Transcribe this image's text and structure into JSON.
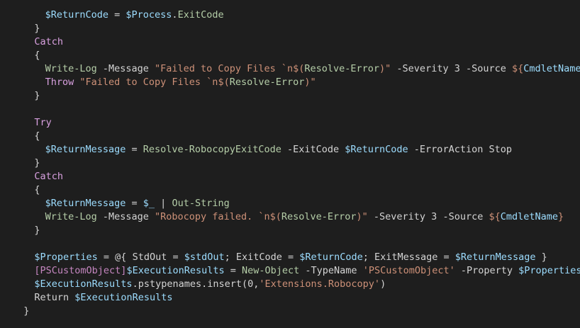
{
  "editor": {
    "theme": {
      "background": "#1e1e1e",
      "text": "#d4d4d4",
      "variable": "#9cdcfe",
      "keyword": "#d8a0df",
      "cmdlet": "#b5cea8",
      "string": "#ce9178",
      "type": "#c586c0"
    },
    "lines": [
      {
        "indent": 3,
        "tokens": [
          [
            "var",
            "$ReturnCode"
          ],
          [
            "default",
            " = "
          ],
          [
            "var",
            "$Process"
          ],
          [
            "default",
            "."
          ],
          [
            "cmdlet",
            "ExitCode"
          ]
        ]
      },
      {
        "indent": 2,
        "tokens": [
          [
            "default",
            "}"
          ]
        ]
      },
      {
        "indent": 2,
        "tokens": [
          [
            "keyword",
            "Catch"
          ]
        ]
      },
      {
        "indent": 2,
        "tokens": [
          [
            "default",
            "{"
          ]
        ]
      },
      {
        "indent": 3,
        "tokens": [
          [
            "cmdlet",
            "Write-Log"
          ],
          [
            "default",
            " -Message "
          ],
          [
            "string",
            "\"Failed to Copy Files `n$("
          ],
          [
            "cmdlet",
            "Resolve-Error"
          ],
          [
            "string",
            ")\""
          ],
          [
            "default",
            " -Severity 3 -Source "
          ],
          [
            "string",
            "${"
          ],
          [
            "var",
            "CmdletName"
          ],
          [
            "string",
            "}"
          ]
        ]
      },
      {
        "indent": 3,
        "tokens": [
          [
            "keyword",
            "Throw"
          ],
          [
            "default",
            " "
          ],
          [
            "string",
            "\"Failed to Copy Files `n$("
          ],
          [
            "cmdlet",
            "Resolve-Error"
          ],
          [
            "string",
            ")\""
          ]
        ]
      },
      {
        "indent": 2,
        "tokens": [
          [
            "default",
            "}"
          ]
        ]
      },
      {
        "indent": 0,
        "tokens": []
      },
      {
        "indent": 2,
        "tokens": [
          [
            "keyword",
            "Try"
          ]
        ]
      },
      {
        "indent": 2,
        "tokens": [
          [
            "default",
            "{"
          ]
        ]
      },
      {
        "indent": 3,
        "tokens": [
          [
            "var",
            "$ReturnMessage"
          ],
          [
            "default",
            " = "
          ],
          [
            "cmdlet",
            "Resolve-RobocopyExitCode"
          ],
          [
            "default",
            " -ExitCode "
          ],
          [
            "var",
            "$ReturnCode"
          ],
          [
            "default",
            " -ErrorAction Stop"
          ]
        ]
      },
      {
        "indent": 2,
        "tokens": [
          [
            "default",
            "}"
          ]
        ]
      },
      {
        "indent": 2,
        "tokens": [
          [
            "keyword",
            "Catch"
          ]
        ]
      },
      {
        "indent": 2,
        "tokens": [
          [
            "default",
            "{"
          ]
        ]
      },
      {
        "indent": 3,
        "tokens": [
          [
            "var",
            "$ReturnMessage"
          ],
          [
            "default",
            " = "
          ],
          [
            "var",
            "$_"
          ],
          [
            "default",
            " | "
          ],
          [
            "cmdlet",
            "Out-String"
          ]
        ]
      },
      {
        "indent": 3,
        "tokens": [
          [
            "cmdlet",
            "Write-Log"
          ],
          [
            "default",
            " -Message "
          ],
          [
            "string",
            "\"Robocopy failed. `n$("
          ],
          [
            "cmdlet",
            "Resolve-Error"
          ],
          [
            "string",
            ")\""
          ],
          [
            "default",
            " -Severity 3 -Source "
          ],
          [
            "string",
            "${"
          ],
          [
            "var",
            "CmdletName"
          ],
          [
            "string",
            "}"
          ]
        ]
      },
      {
        "indent": 2,
        "tokens": [
          [
            "default",
            "}"
          ]
        ]
      },
      {
        "indent": 0,
        "tokens": []
      },
      {
        "indent": 2,
        "tokens": [
          [
            "var",
            "$Properties"
          ],
          [
            "default",
            " = @{ StdOut = "
          ],
          [
            "var",
            "$stdOut"
          ],
          [
            "default",
            "; ExitCode = "
          ],
          [
            "var",
            "$ReturnCode"
          ],
          [
            "default",
            "; ExitMessage = "
          ],
          [
            "var",
            "$ReturnMessage"
          ],
          [
            "default",
            " }"
          ]
        ]
      },
      {
        "indent": 2,
        "tokens": [
          [
            "type",
            "[PSCustomObject]"
          ],
          [
            "var",
            "$ExecutionResults"
          ],
          [
            "default",
            " = "
          ],
          [
            "cmdlet",
            "New-Object"
          ],
          [
            "default",
            " -TypeName "
          ],
          [
            "string",
            "'PSCustomObject'"
          ],
          [
            "default",
            " -Property "
          ],
          [
            "var",
            "$Properties"
          ]
        ]
      },
      {
        "indent": 2,
        "tokens": [
          [
            "var",
            "$ExecutionResults"
          ],
          [
            "default",
            ".pstypenames.insert(0,"
          ],
          [
            "string",
            "'Extensions.Robocopy'"
          ],
          [
            "default",
            ")"
          ]
        ]
      },
      {
        "indent": 2,
        "tokens": [
          [
            "default",
            "Return "
          ],
          [
            "var",
            "$ExecutionResults"
          ]
        ]
      },
      {
        "indent": 1,
        "tokens": [
          [
            "default",
            "}"
          ]
        ]
      }
    ]
  }
}
